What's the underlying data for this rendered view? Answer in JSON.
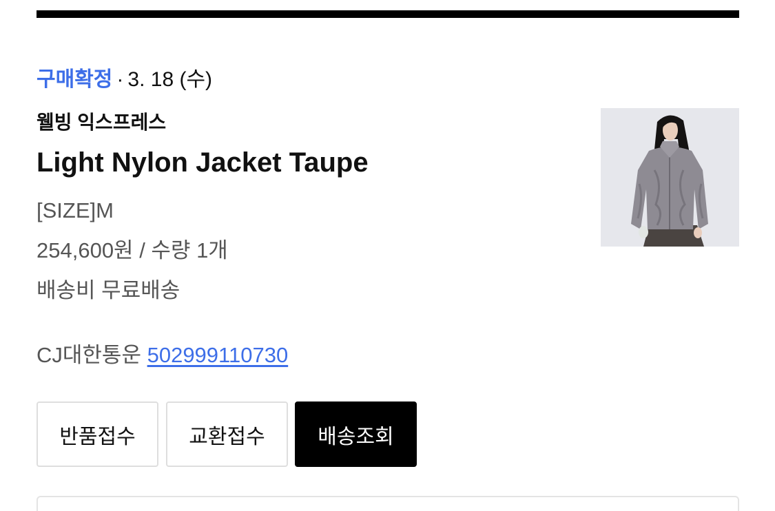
{
  "order": {
    "status_label": "구매확정",
    "separator": "·",
    "date": "3. 18 (수)",
    "brand": "웰빙 익스프레스",
    "product_name": "Light Nylon Jacket Taupe",
    "option": "[SIZE]M",
    "price_quantity": "254,600원 / 수량 1개",
    "shipping_fee": "배송비 무료배송",
    "carrier": "CJ대한통운",
    "tracking_number": "502999110730",
    "thumbnail_icon": "product-photo-jacket"
  },
  "actions": {
    "return_label": "반품접수",
    "exchange_label": "교환접수",
    "tracking_label": "배송조회"
  },
  "colors": {
    "accent": "#3d6ee8",
    "primary_button": "#000000"
  }
}
